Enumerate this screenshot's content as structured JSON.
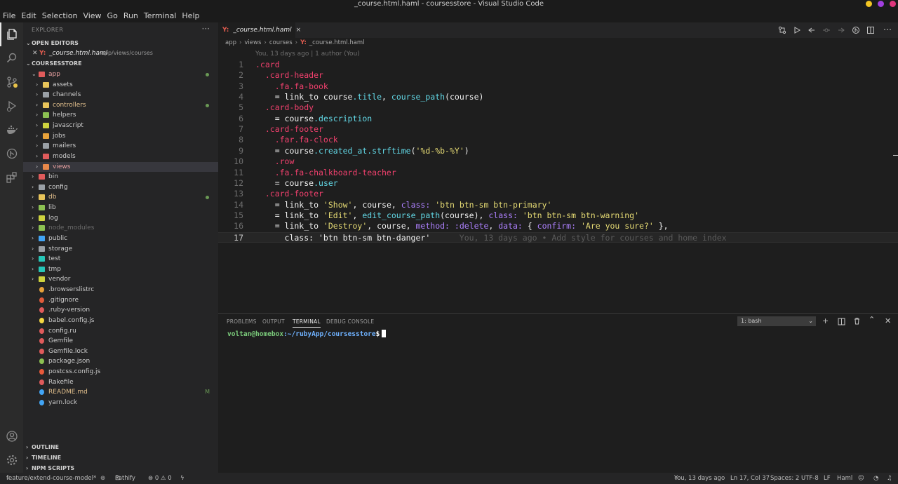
{
  "window": {
    "title": "_course.html.haml - coursesstore - Visual Studio Code",
    "controls_colors": [
      "#f3c623",
      "#a23fe0",
      "#e0367c"
    ]
  },
  "menu": [
    "File",
    "Edit",
    "Selection",
    "View",
    "Go",
    "Run",
    "Terminal",
    "Help"
  ],
  "sidebar": {
    "title": "EXPLORER",
    "more": "···",
    "open_editors_label": "OPEN EDITORS",
    "open_editor": {
      "name": "_course.html.haml",
      "path": "app/views/courses"
    },
    "project_label": "COURSESSTORE",
    "tree": [
      {
        "label": "app",
        "depth": 0,
        "type": "folder-open",
        "color": "#e05b5b",
        "text_color": "#e8a0a0",
        "dot": true
      },
      {
        "label": "assets",
        "depth": 1,
        "type": "folder",
        "color": "#e8c45a"
      },
      {
        "label": "channels",
        "depth": 1,
        "type": "folder",
        "color": "#9aa0a6"
      },
      {
        "label": "controllers",
        "depth": 1,
        "type": "folder",
        "color": "#e8c45a",
        "text_color": "#e2c08d",
        "dot": true
      },
      {
        "label": "helpers",
        "depth": 1,
        "type": "folder",
        "color": "#8cc152"
      },
      {
        "label": "javascript",
        "depth": 1,
        "type": "folder",
        "color": "#cdd23e"
      },
      {
        "label": "jobs",
        "depth": 1,
        "type": "folder",
        "color": "#e8a23a"
      },
      {
        "label": "mailers",
        "depth": 1,
        "type": "folder",
        "color": "#9aa0a6"
      },
      {
        "label": "models",
        "depth": 1,
        "type": "folder",
        "color": "#e05b5b"
      },
      {
        "label": "views",
        "depth": 1,
        "type": "folder",
        "color": "#e8884a",
        "text_color": "#e8a0a0",
        "selected": true
      },
      {
        "label": "bin",
        "depth": 0,
        "type": "folder",
        "color": "#e05b5b"
      },
      {
        "label": "config",
        "depth": 0,
        "type": "folder",
        "color": "#9aa0a6"
      },
      {
        "label": "db",
        "depth": 0,
        "type": "folder",
        "color": "#e8c45a",
        "text_color": "#e2c08d",
        "dot": true
      },
      {
        "label": "lib",
        "depth": 0,
        "type": "folder",
        "color": "#8cc152"
      },
      {
        "label": "log",
        "depth": 0,
        "type": "folder",
        "color": "#cdd23e"
      },
      {
        "label": "node_modules",
        "depth": 0,
        "type": "folder",
        "color": "#8cc152",
        "text_color": "#6b6b6b"
      },
      {
        "label": "public",
        "depth": 0,
        "type": "folder",
        "color": "#42a5f5"
      },
      {
        "label": "storage",
        "depth": 0,
        "type": "folder",
        "color": "#9aa0a6"
      },
      {
        "label": "test",
        "depth": 0,
        "type": "folder",
        "color": "#26c6b8"
      },
      {
        "label": "tmp",
        "depth": 0,
        "type": "folder",
        "color": "#26c6b8"
      },
      {
        "label": "vendor",
        "depth": 0,
        "type": "folder",
        "color": "#cdd23e"
      },
      {
        "label": ".browserslistrc",
        "depth": 0,
        "type": "file",
        "color": "#e8a23a"
      },
      {
        "label": ".gitignore",
        "depth": 0,
        "type": "file",
        "color": "#e05b3a"
      },
      {
        "label": ".ruby-version",
        "depth": 0,
        "type": "file",
        "color": "#e05b5b"
      },
      {
        "label": "babel.config.js",
        "depth": 0,
        "type": "file",
        "color": "#f5d742"
      },
      {
        "label": "config.ru",
        "depth": 0,
        "type": "file",
        "color": "#e05b5b"
      },
      {
        "label": "Gemfile",
        "depth": 0,
        "type": "file",
        "color": "#e05b5b"
      },
      {
        "label": "Gemfile.lock",
        "depth": 0,
        "type": "file",
        "color": "#e05b5b"
      },
      {
        "label": "package.json",
        "depth": 0,
        "type": "file",
        "color": "#8cc152"
      },
      {
        "label": "postcss.config.js",
        "depth": 0,
        "type": "file",
        "color": "#e8593a"
      },
      {
        "label": "Rakefile",
        "depth": 0,
        "type": "file",
        "color": "#e05b5b"
      },
      {
        "label": "README.md",
        "depth": 0,
        "type": "file",
        "color": "#42a5f5",
        "text_color": "#e2c08d",
        "badge": "M"
      },
      {
        "label": "yarn.lock",
        "depth": 0,
        "type": "file",
        "color": "#42a5f5"
      }
    ],
    "bottom_sections": [
      "OUTLINE",
      "TIMELINE",
      "NPM SCRIPTS"
    ]
  },
  "editor": {
    "tab": {
      "icon": "Y:",
      "name": "_course.html.haml",
      "close": "×"
    },
    "breadcrumb": [
      "app",
      "views",
      "courses",
      "_course.html.haml"
    ],
    "breadcrumb_icon": "Y:",
    "blame_header": "You, 13 days ago | 1 author (You)",
    "current_line": 17,
    "lines": [
      [
        [
          "sel",
          ".card"
        ]
      ],
      [
        [
          "sel",
          "  .card-header"
        ]
      ],
      [
        [
          "sel",
          "    .fa.fa-book"
        ]
      ],
      [
        [
          "plain",
          "    = link_to course"
        ],
        [
          "prop",
          ".title"
        ],
        [
          "plain",
          ", "
        ],
        [
          "prop",
          "course_path"
        ],
        [
          "plain",
          "(course)"
        ]
      ],
      [
        [
          "sel",
          "  .card-body"
        ]
      ],
      [
        [
          "plain",
          "    = course"
        ],
        [
          "prop",
          ".description"
        ]
      ],
      [
        [
          "sel",
          "  .card-footer"
        ]
      ],
      [
        [
          "sel",
          "    .far.fa-clock"
        ]
      ],
      [
        [
          "plain",
          "    = course"
        ],
        [
          "prop",
          ".created_at.strftime"
        ],
        [
          "plain",
          "("
        ],
        [
          "str",
          "'%d-%b-%Y'"
        ],
        [
          "plain",
          ")"
        ]
      ],
      [
        [
          "sel",
          "    .row"
        ]
      ],
      [
        [
          "sel",
          "    .fa.fa-chalkboard-teacher"
        ]
      ],
      [
        [
          "plain",
          "    = course"
        ],
        [
          "prop",
          ".user"
        ]
      ],
      [
        [
          "sel",
          "  .card-footer"
        ]
      ],
      [
        [
          "plain",
          "    = link_to "
        ],
        [
          "str",
          "'Show'"
        ],
        [
          "plain",
          ", course, "
        ],
        [
          "key",
          "class:"
        ],
        [
          "plain",
          " "
        ],
        [
          "str",
          "'btn btn-sm btn-primary'"
        ]
      ],
      [
        [
          "plain",
          "    = link_to "
        ],
        [
          "str",
          "'Edit'"
        ],
        [
          "plain",
          ", "
        ],
        [
          "prop",
          "edit_course_path"
        ],
        [
          "plain",
          "(course), "
        ],
        [
          "key",
          "class:"
        ],
        [
          "plain",
          " "
        ],
        [
          "str",
          "'btn btn-sm btn-warning'"
        ]
      ],
      [
        [
          "plain",
          "    = link_to "
        ],
        [
          "str",
          "'Destroy'"
        ],
        [
          "plain",
          ", course, "
        ],
        [
          "key",
          "method:"
        ],
        [
          "plain",
          " "
        ],
        [
          "key",
          ":delete"
        ],
        [
          "plain",
          ", "
        ],
        [
          "key",
          "data:"
        ],
        [
          "plain",
          " { "
        ],
        [
          "key",
          "confirm:"
        ],
        [
          "plain",
          " "
        ],
        [
          "str",
          "'Are you sure?'"
        ],
        [
          "plain",
          " },"
        ]
      ],
      [
        [
          "plain",
          "      class: 'btn btn-sm btn-danger'"
        ],
        [
          "ann",
          "      You, 13 days ago • Add style for courses and home index"
        ]
      ]
    ]
  },
  "panel": {
    "tabs": [
      "PROBLEMS",
      "OUTPUT",
      "TERMINAL",
      "DEBUG CONSOLE"
    ],
    "active_tab": "TERMINAL",
    "terminal_select": "1: bash",
    "prompt_user": "voltan@homebox",
    "prompt_path": ":~/rubyApp/coursesstore",
    "prompt_symbol": "$"
  },
  "statusbar": {
    "branch": "feature/extend-course-model*",
    "pathify": "Pathify",
    "problems": "⊗ 0 ⚠ 0",
    "blame": "You, 13 days ago",
    "position": "Ln 17, Col 37",
    "spaces": "Spaces: 2",
    "encoding": "UTF-8",
    "eol": "LF",
    "language": "Haml"
  }
}
